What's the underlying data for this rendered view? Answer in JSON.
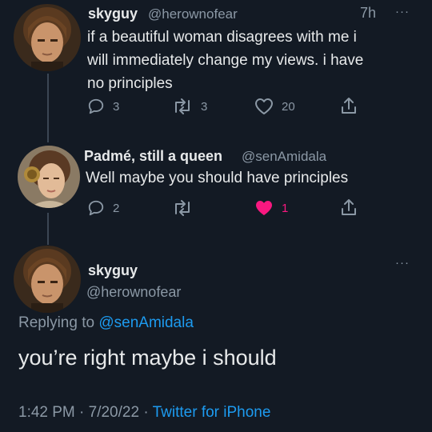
{
  "tweet1": {
    "name": "skyguy",
    "handle": "@herownofear",
    "time": "7h",
    "menu": "···",
    "lines": [
      "if a beautiful woman disagrees with me i",
      "will immediately change my views. i have",
      "no principles"
    ],
    "replies": "3",
    "retweets": "3",
    "likes": "20"
  },
  "tweet2": {
    "name": "Padmé, still a queen",
    "handle": "@senAmidala",
    "text": "Well maybe you should have principles",
    "replies": "2",
    "likes": "1",
    "like_color": "#f91880"
  },
  "tweet3": {
    "name": "skyguy",
    "handle": "@herownofear",
    "menu": "···",
    "replying_prefix": "Replying to",
    "replying_handle": "@senAmidala",
    "text": "you’re right maybe i should",
    "timestamp": "1:42 PM · 7/20/22 ·",
    "source": "Twitter for iPhone"
  },
  "colors": {
    "background": "#131a24",
    "accent": "#1d9bf0",
    "secondary_text": "#8b98a5",
    "like": "#f91880"
  }
}
